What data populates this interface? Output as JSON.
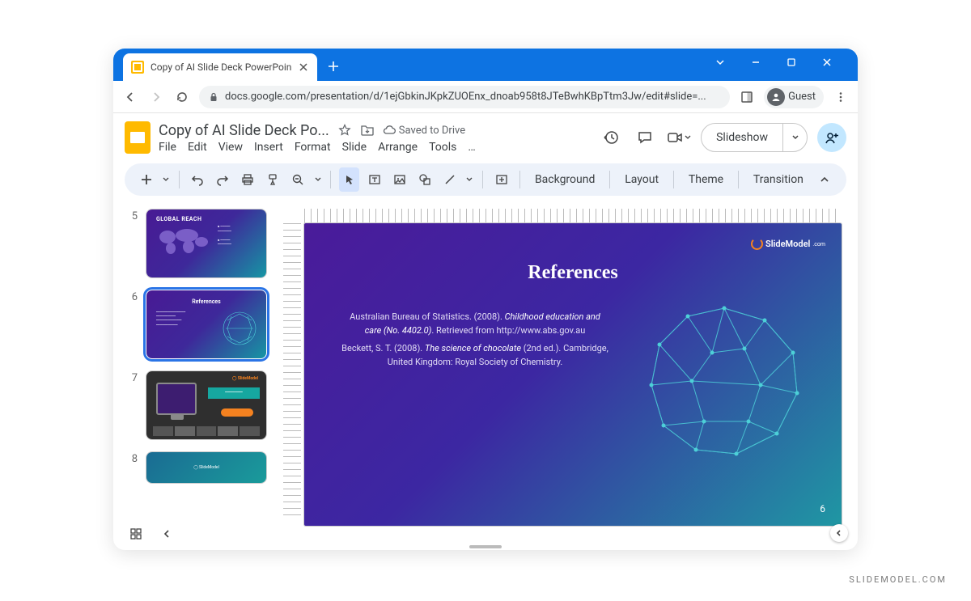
{
  "browser": {
    "tab_title": "Copy of AI Slide Deck PowerPoin",
    "url": "docs.google.com/presentation/d/1ejGbkinJKpkZUOEnx_dnoab958t8JTeBwhKBpTtm3Jw/edit#slide=...",
    "guest_label": "Guest"
  },
  "doc": {
    "title": "Copy of AI Slide Deck Po...",
    "saved_status": "Saved to Drive",
    "menus": [
      "File",
      "Edit",
      "View",
      "Insert",
      "Format",
      "Slide",
      "Arrange",
      "Tools",
      "…"
    ]
  },
  "actions": {
    "slideshow": "Slideshow"
  },
  "toolbar": {
    "labels": {
      "background": "Background",
      "layout": "Layout",
      "theme": "Theme",
      "transition": "Transition"
    }
  },
  "filmstrip": {
    "slides": [
      {
        "num": "5",
        "title": "GLOBAL REACH"
      },
      {
        "num": "6",
        "title": "References"
      },
      {
        "num": "7",
        "title": ""
      },
      {
        "num": "8",
        "title": ""
      }
    ]
  },
  "slide": {
    "badge": "SlideModel",
    "title": "References",
    "ref1_a": "Australian Bureau of Statistics. (2008). ",
    "ref1_b": "Childhood education and care (No. 4402.0)",
    "ref1_c": ". Retrieved from http://www.abs.gov.au",
    "ref2_a": "Beckett, S. T. (2008). ",
    "ref2_b": "The science of chocolate",
    "ref2_c": " (2nd ed.). Cambridge, United Kingdom: Royal Society of Chemistry.",
    "page_number": "6"
  },
  "watermark": "SLIDEMODEL.COM"
}
